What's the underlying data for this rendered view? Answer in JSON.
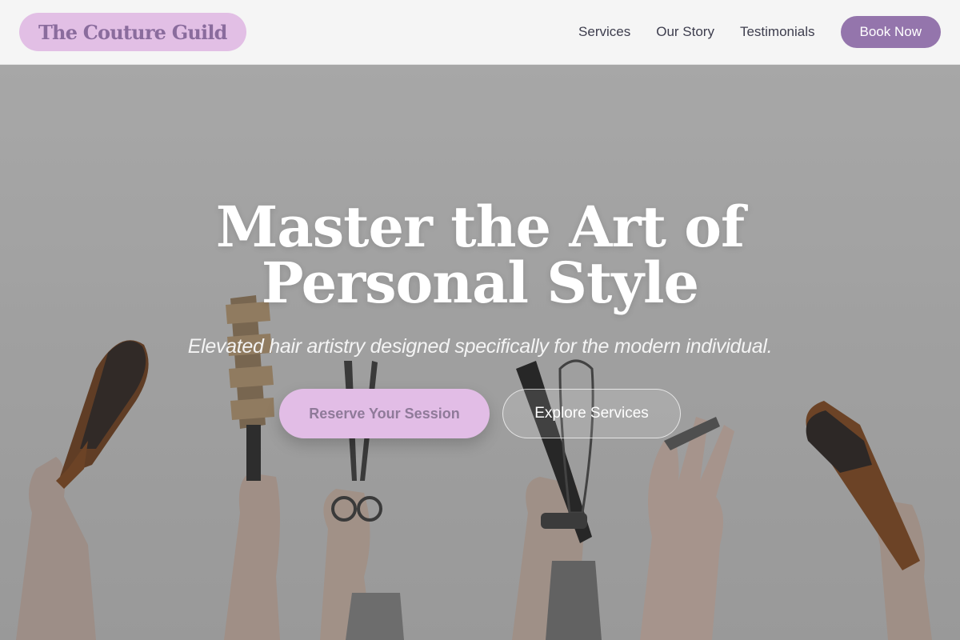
{
  "brand": {
    "name": "The Couture Guild"
  },
  "nav": {
    "links": [
      "Services",
      "Our Story",
      "Testimonials"
    ],
    "cta": "Book Now"
  },
  "hero": {
    "title": "Master the Art of Personal Style",
    "subtitle": "Elevated hair artistry designed specifically for the modern individual.",
    "primary_button": "Reserve Your Session",
    "secondary_button": "Explore Services",
    "image_subject": "raised hands holding hair brushes, scissors and styling tools"
  },
  "colors": {
    "accent_purple": "#9475ac",
    "accent_pink": "#e2bfe5",
    "logo_text": "#8a6c9d",
    "nav_text": "#3d3d4d"
  }
}
